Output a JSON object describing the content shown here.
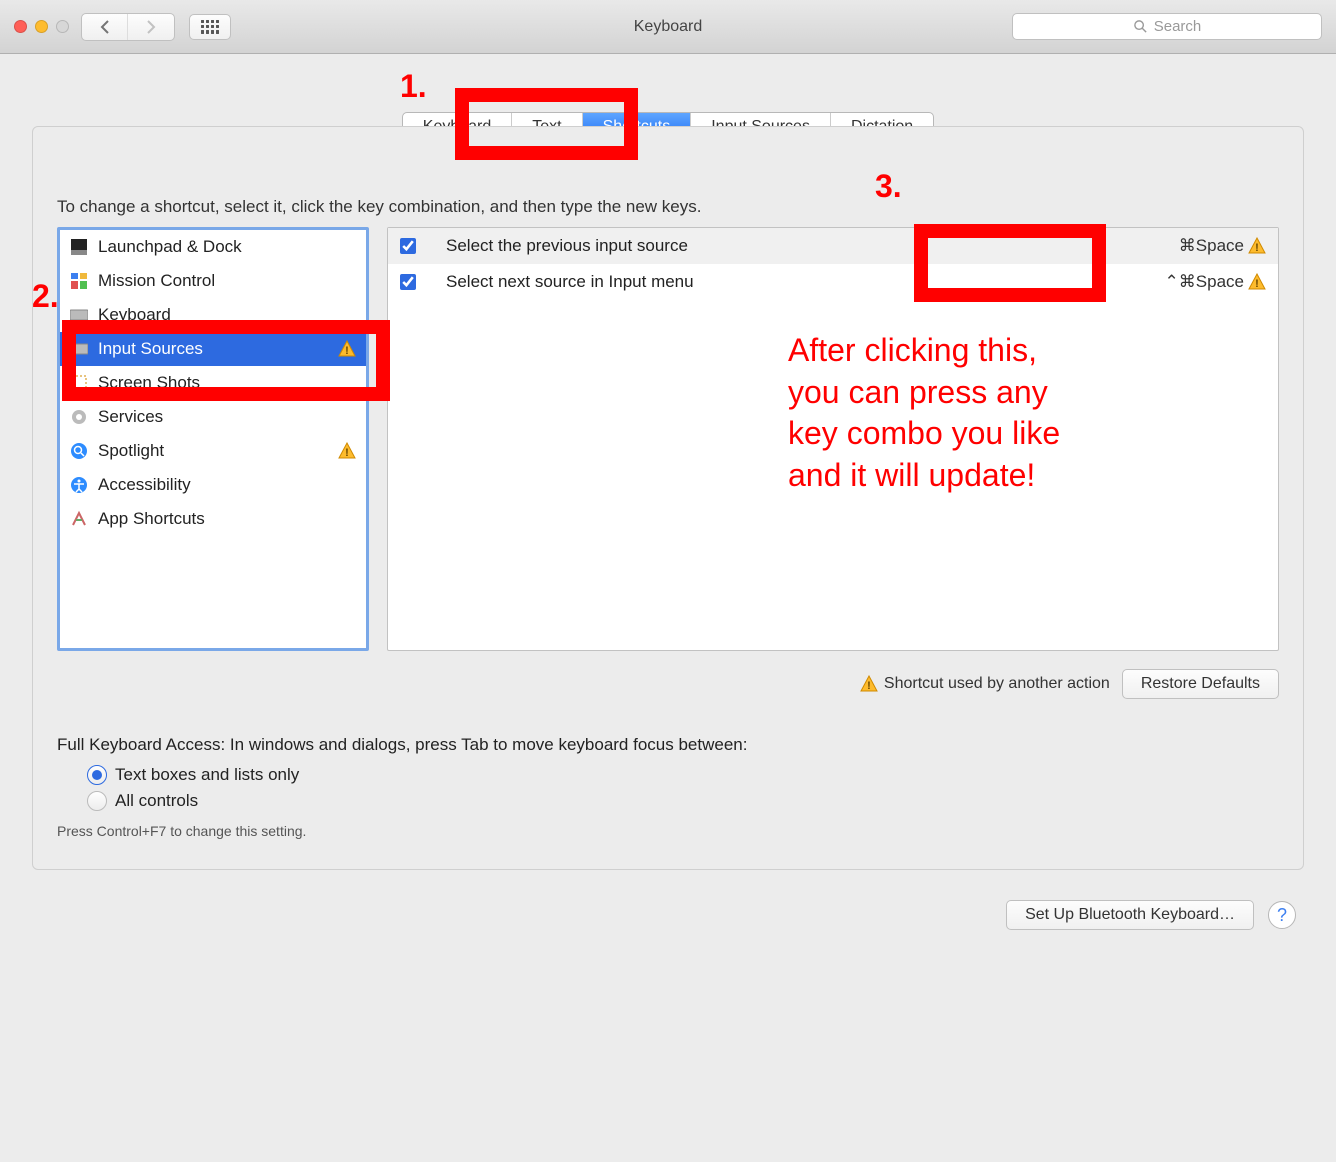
{
  "titlebar": {
    "title": "Keyboard",
    "search_placeholder": "Search"
  },
  "tabs": [
    {
      "label": "Keyboard"
    },
    {
      "label": "Text"
    },
    {
      "label": "Shortcuts"
    },
    {
      "label": "Input Sources"
    },
    {
      "label": "Dictation"
    }
  ],
  "panel": {
    "hint": "To change a shortcut, select it, click the key combination, and then type the new keys."
  },
  "categories": [
    {
      "label": "Launchpad & Dock"
    },
    {
      "label": "Mission Control"
    },
    {
      "label": "Keyboard"
    },
    {
      "label": "Input Sources"
    },
    {
      "label": "Screen Shots"
    },
    {
      "label": "Services"
    },
    {
      "label": "Spotlight"
    },
    {
      "label": "Accessibility"
    },
    {
      "label": "App Shortcuts"
    }
  ],
  "shortcuts": [
    {
      "label": "Select the previous input source",
      "keys": "⌘Space"
    },
    {
      "label": "Select next source in Input menu",
      "keys": "⌃⌘Space"
    }
  ],
  "footer": {
    "conflict_label": "Shortcut used by another action",
    "restore_label": "Restore Defaults"
  },
  "fka": {
    "title": "Full Keyboard Access: In windows and dialogs, press Tab to move keyboard focus between:",
    "opt1": "Text boxes and lists only",
    "opt2": "All controls",
    "hint": "Press Control+F7 to change this setting."
  },
  "bottom": {
    "bluetooth_label": "Set Up Bluetooth Keyboard…"
  },
  "annotations": {
    "n1": "1.",
    "n2": "2.",
    "n3": "3.",
    "text": "After clicking this,\nyou can press any\nkey combo you like\nand it will update!"
  }
}
